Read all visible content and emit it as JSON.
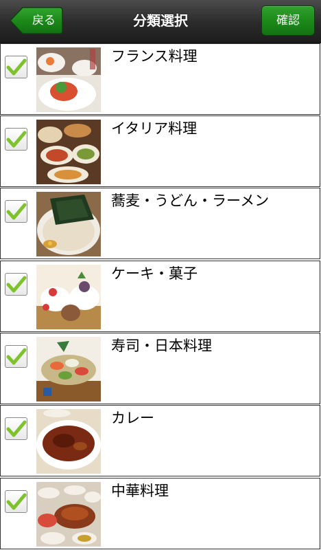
{
  "header": {
    "title": "分類選択",
    "back_label": "戻る",
    "confirm_label": "確認"
  },
  "colors": {
    "accent_green": "#1c8a1a",
    "check_green": "#7ec22e",
    "navbar": "#2a2a2a"
  },
  "categories": [
    {
      "label": "フランス料理",
      "checked": true,
      "image": "french-food-photo"
    },
    {
      "label": "イタリア料理",
      "checked": true,
      "image": "italian-food-photo"
    },
    {
      "label": "蕎麦・うどん・ラーメン",
      "checked": true,
      "image": "noodle-photo"
    },
    {
      "label": "ケーキ・菓子",
      "checked": true,
      "image": "cake-photo"
    },
    {
      "label": "寿司・日本料理",
      "checked": true,
      "image": "sushi-photo"
    },
    {
      "label": "カレー",
      "checked": true,
      "image": "curry-photo"
    },
    {
      "label": "中華料理",
      "checked": true,
      "image": "chinese-food-photo"
    }
  ]
}
